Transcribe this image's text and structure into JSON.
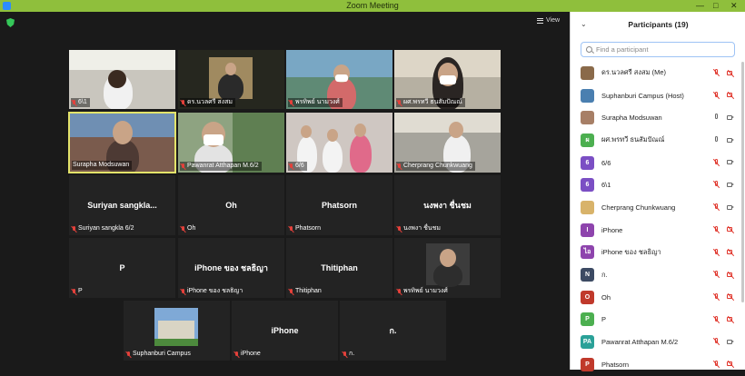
{
  "window": {
    "title": "Zoom Meeting"
  },
  "toolbar": {
    "view_label": "View"
  },
  "tiles": [
    {
      "name": "6\\1"
    },
    {
      "name": "ดร.นวลศรี สงสม"
    },
    {
      "name": "พรทิพย์ นามวงศ์"
    },
    {
      "name": "ผศ.พรทวี ธนสัมปัณณ์"
    },
    {
      "name": "Surapha Modsuwan"
    },
    {
      "name": "Pawanrat Atthapan M.6/2"
    },
    {
      "name": "6/6"
    },
    {
      "name": "Cherprang Chunkwuang"
    },
    {
      "name": "Suriyan sangkla 6/2",
      "display": "Suriyan sangkla..."
    },
    {
      "name": "Oh",
      "display": "Oh"
    },
    {
      "name": "Phatsorn",
      "display": "Phatsorn"
    },
    {
      "name": "นงพงา ชื่นชม",
      "display": "นงพงา ชื่นชม"
    },
    {
      "name": "P",
      "display": "P"
    },
    {
      "name": "iPhone ของ ชลธิญา",
      "display": "iPhone ของ ชลธิญา"
    },
    {
      "name": "Thitiphan",
      "display": "Thitiphan"
    },
    {
      "name": "พรทิพย์ นามวงศ์"
    },
    {
      "name": "Suphanburi Campus"
    },
    {
      "name": "iPhone",
      "display": "iPhone"
    },
    {
      "name": "ก.",
      "display": "ก."
    }
  ],
  "participants_panel": {
    "title": "Participants (19)",
    "search_placeholder": "Find a participant",
    "items": [
      {
        "name": "ดร.นวลศรี สงสม (Me)",
        "avatar": "",
        "avatar_color": "#8a6a4a",
        "mic": "off",
        "cam": "off"
      },
      {
        "name": "Suphanburi Campus (Host)",
        "avatar": "",
        "avatar_color": "#4a7fb0",
        "mic": "off",
        "cam": "off"
      },
      {
        "name": "Surapha Modsuwan",
        "avatar": "",
        "avatar_color": "#a77f66",
        "mic": "on",
        "cam": "on"
      },
      {
        "name": "ผศ.พรทวี ธนสัมปัณณ์",
        "avatar": "ผ",
        "avatar_color": "#4caf50",
        "mic": "on",
        "cam": "on"
      },
      {
        "name": "6/6",
        "avatar": "6",
        "avatar_color": "#7b4fc4",
        "mic": "off",
        "cam": "on"
      },
      {
        "name": "6\\1",
        "avatar": "6",
        "avatar_color": "#7b4fc4",
        "mic": "off",
        "cam": "on"
      },
      {
        "name": "Cherprang Chunkwuang",
        "avatar": "",
        "avatar_color": "#d8b36a",
        "mic": "off",
        "cam": "on"
      },
      {
        "name": "iPhone",
        "avatar": "I",
        "avatar_color": "#8e44ad",
        "mic": "off",
        "cam": "off"
      },
      {
        "name": "iPhone ของ ชลธิญา",
        "avatar": "ไอ",
        "avatar_color": "#8e44ad",
        "mic": "off",
        "cam": "off"
      },
      {
        "name": "ก.",
        "avatar": "N",
        "avatar_color": "#3c4a63",
        "mic": "off",
        "cam": "off"
      },
      {
        "name": "Oh",
        "avatar": "O",
        "avatar_color": "#c0392b",
        "mic": "off",
        "cam": "off"
      },
      {
        "name": "P",
        "avatar": "P",
        "avatar_color": "#4caf50",
        "mic": "off",
        "cam": "off"
      },
      {
        "name": "Pawanrat Atthapan M.6/2",
        "avatar": "PA",
        "avatar_color": "#2aa198",
        "mic": "off",
        "cam": "on"
      },
      {
        "name": "Phatsorn",
        "avatar": "P",
        "avatar_color": "#c0392b",
        "mic": "off",
        "cam": "off"
      }
    ]
  }
}
